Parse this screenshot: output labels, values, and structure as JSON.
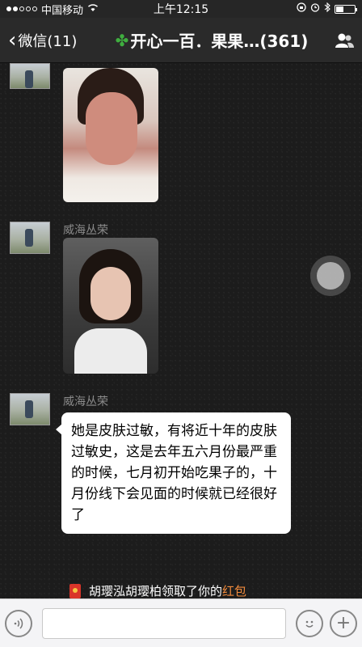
{
  "status_bar": {
    "carrier": "中国移动",
    "time": "上午12:15"
  },
  "nav": {
    "back_label": "微信(11)",
    "title": "开心一百．果果…(361)"
  },
  "messages": [
    {
      "sender": "",
      "type": "image",
      "description_icon": "photo"
    },
    {
      "sender": "威海丛荣",
      "type": "image"
    },
    {
      "sender": "威海丛荣",
      "type": "text",
      "text": "她是皮肤过敏，有将近十年的皮肤过敏史，这是去年五六月份最严重的时候，七月初开始吃果子的，十月份线下会见面的时候就已经很好了"
    }
  ],
  "system_notice": {
    "prefix": "胡璎泓胡璎柏领取了你的",
    "link": "红包"
  },
  "input_bar": {
    "voice_icon": "voice-icon",
    "emoji_icon": "emoji-icon",
    "plus_icon": "plus-icon"
  },
  "colors": {
    "accent_link": "#f08a3c",
    "redpacket": "#d9352a",
    "clover": "#3fae3f"
  }
}
